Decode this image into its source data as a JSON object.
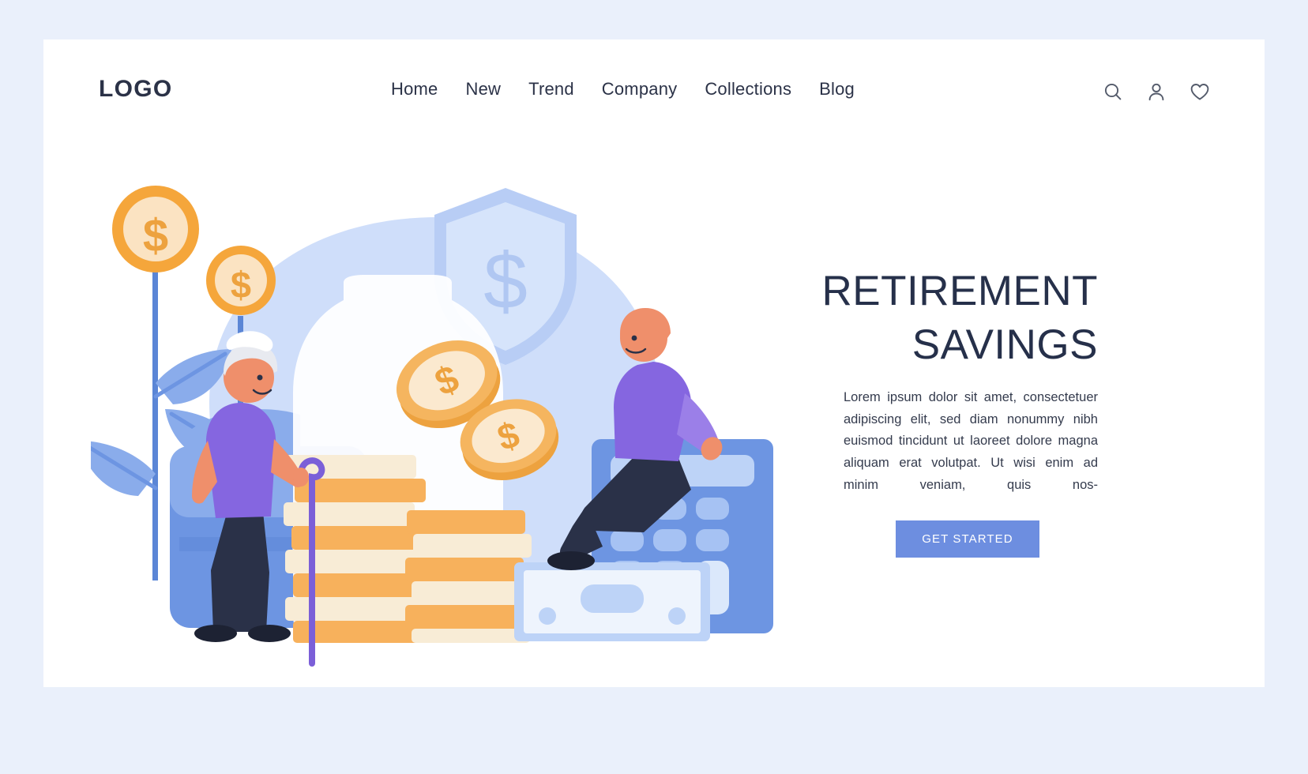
{
  "brand": {
    "logo_text": "LOGO"
  },
  "nav": {
    "items": [
      {
        "label": "Home"
      },
      {
        "label": "New"
      },
      {
        "label": "Trend"
      },
      {
        "label": "Company"
      },
      {
        "label": "Collections"
      },
      {
        "label": "Blog"
      }
    ]
  },
  "actions": {
    "search": "search-icon",
    "account": "user-icon",
    "favorites": "heart-icon"
  },
  "hero": {
    "headline": "RETIREMENT SAVINGS",
    "body": "Lorem ipsum dolor sit amet, consectetuer adipiscing elit, sed diam nonummy nibh euismod tincidunt ut laoreet dolore magna aliquam erat volutpat. Ut wisi enim ad minim veniam, quis nos-",
    "cta_label": "GET STARTED"
  },
  "illustration": {
    "alt": "retirement savings flat illustration: coin plants, security shield with dollar, jar of coins, stacks of coins, banknote, calculator, elderly woman with cane, man sitting on calculator",
    "elements": [
      "coin-plant-large",
      "coin-plant-small",
      "shield-dollar",
      "savings-jar",
      "coin-stack-left",
      "coin-stack-right",
      "falling-coin-top",
      "falling-coin-bottom",
      "banknote",
      "calculator",
      "elderly-woman",
      "seated-man",
      "sofa"
    ]
  },
  "colors": {
    "page_background": "#eaf0fb",
    "card_background": "#ffffff",
    "text_dark": "#2b3247",
    "headline": "#26304a",
    "accent_blue": "#6d8ee0",
    "illustration_blue_light": "#c3d7f7",
    "illustration_blue": "#7b9fe8",
    "illustration_blue_deep": "#5b86d6",
    "coin_orange": "#f5a63b",
    "coin_cream": "#fbe9cf",
    "purple_shirt": "#8566e0",
    "navy_pants": "#2a3148",
    "skin": "#ef8f6b"
  }
}
